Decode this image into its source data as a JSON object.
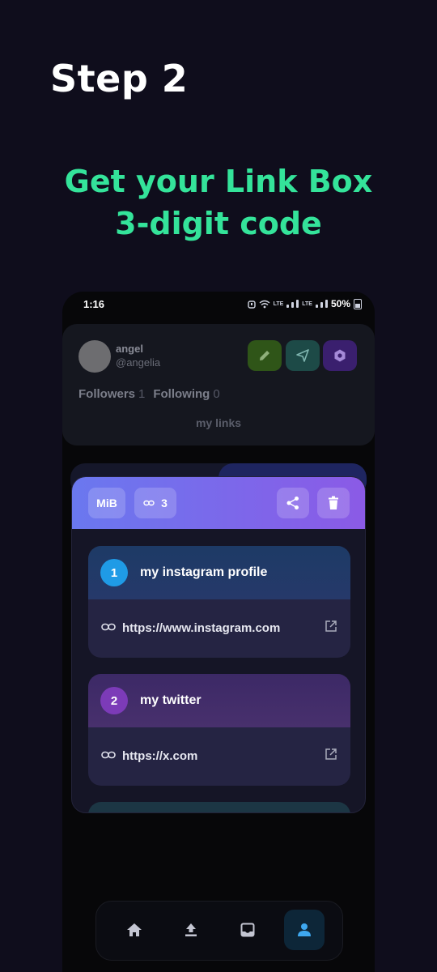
{
  "intro": {
    "step_title": "Step 2",
    "subtitle_line1": "Get your Link Box",
    "subtitle_line2": "3-digit code"
  },
  "status_bar": {
    "time": "1:16",
    "battery": "50%",
    "network": "LTE"
  },
  "profile": {
    "name": "angel",
    "handle": "@angelia",
    "followers_label": "Followers",
    "followers_count": "1",
    "following_label": "Following",
    "following_count": "0",
    "section_label": "my links"
  },
  "modal": {
    "code_chip": "MiB",
    "link_count": "3",
    "header_gradient": [
      "#6a78ef",
      "#8b5ae6"
    ],
    "links": [
      {
        "number": "1",
        "title": "my instagram profile",
        "url": "https://www.instagram.com",
        "accent": "#1f9be6"
      },
      {
        "number": "2",
        "title": "my twitter",
        "url": "https://x.com",
        "accent": "#7c3bb8"
      }
    ]
  },
  "nav": {
    "items": [
      {
        "icon": "home-icon"
      },
      {
        "icon": "upload-icon"
      },
      {
        "icon": "inbox-icon"
      },
      {
        "icon": "profile-icon",
        "active": true
      }
    ]
  },
  "colors": {
    "background": "#0f0d1c",
    "accent_green": "#34e39a"
  }
}
